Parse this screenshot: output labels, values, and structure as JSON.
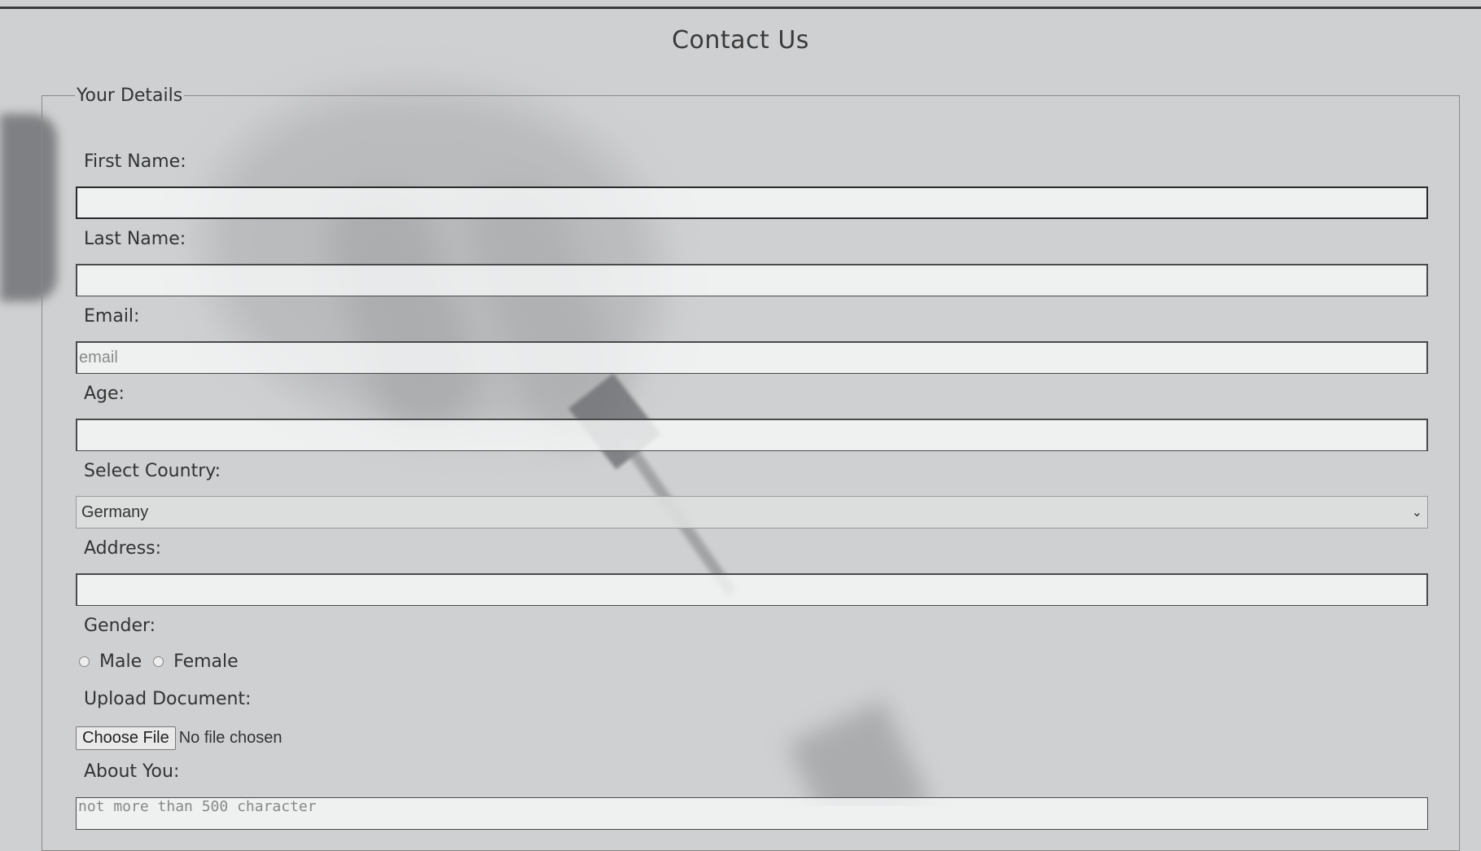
{
  "page": {
    "title": "Contact Us"
  },
  "form": {
    "legend": "Your Details",
    "first_name": {
      "label": "First Name:",
      "value": ""
    },
    "last_name": {
      "label": "Last Name:",
      "value": ""
    },
    "email": {
      "label": "Email:",
      "value": "",
      "placeholder": "email"
    },
    "age": {
      "label": "Age:",
      "value": ""
    },
    "country": {
      "label": "Select Country:",
      "selected": "Germany"
    },
    "address": {
      "label": "Address:",
      "value": ""
    },
    "gender": {
      "label": "Gender:",
      "options": [
        "Male",
        "Female"
      ]
    },
    "upload": {
      "label": "Upload Document:",
      "button": "Choose File",
      "status": "No file chosen"
    },
    "about": {
      "label": "About You:",
      "placeholder": "not more than 500 character"
    }
  }
}
